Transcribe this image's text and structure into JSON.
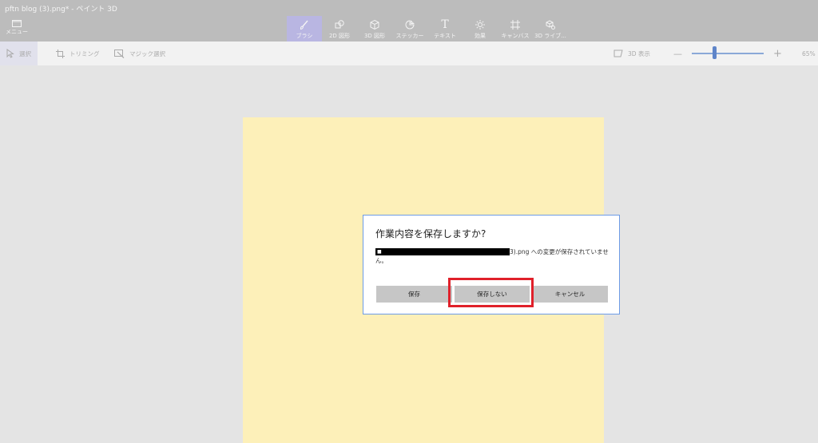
{
  "window": {
    "title": "pftn blog (3).png* - ペイント 3D"
  },
  "menu": {
    "label": "メニュー"
  },
  "ribbon": {
    "tools": [
      {
        "label": "ブラシ",
        "icon": "brush-icon",
        "active": true
      },
      {
        "label": "2D 図形",
        "icon": "shapes-2d-icon"
      },
      {
        "label": "3D 図形",
        "icon": "shapes-3d-icon"
      },
      {
        "label": "ステッカー",
        "icon": "sticker-icon"
      },
      {
        "label": "テキスト",
        "icon": "text-icon"
      },
      {
        "label": "効果",
        "icon": "effects-icon"
      },
      {
        "label": "キャンバス",
        "icon": "canvas-icon"
      },
      {
        "label": "3D ライブ...",
        "icon": "library-3d-icon"
      }
    ]
  },
  "toolbar": {
    "select_label": "選択",
    "crop_label": "トリミング",
    "magic_select_label": "マジック選択",
    "view3d_label": "3D 表示",
    "zoom_out": "—",
    "zoom_in": "+",
    "zoom_value": "65%",
    "zoom_level_percent": 65
  },
  "colors": {
    "accent": "#5f85c9",
    "canvas": "#fdf0b9",
    "highlight": "#e0202a",
    "active_tool": "#b9b6e2"
  },
  "dialog": {
    "title": "作業内容を保存しますか?",
    "message_prefix": "■",
    "message_suffix": "3).png への変更が保存されていません。",
    "save_label": "保存",
    "dont_save_label": "保存しない",
    "cancel_label": "キャンセル"
  }
}
